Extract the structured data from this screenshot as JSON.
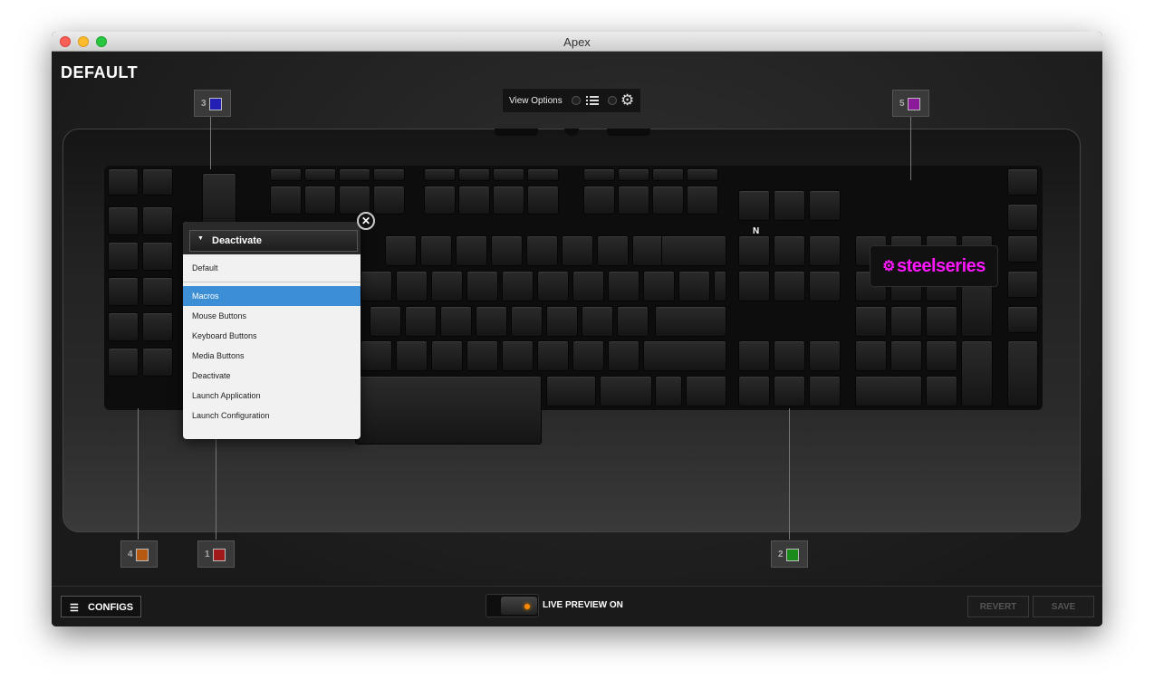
{
  "window": {
    "title": "Apex"
  },
  "config_name": "DEFAULT",
  "view_options": {
    "label": "View Options",
    "list_icon": "list-icon",
    "settings_icon": "gear-icon"
  },
  "colors": {
    "orange": "#ff7a1a",
    "red": "#ff1a1a",
    "green": "#1aff1a",
    "blue": "#2a33ff",
    "magenta": "#ff17ff"
  },
  "callouts": [
    {
      "num": "3",
      "color": "#241fb4"
    },
    {
      "num": "5",
      "color": "#8a1a9a"
    },
    {
      "num": "4",
      "color": "#b55a10"
    },
    {
      "num": "1",
      "color": "#a01a1a"
    },
    {
      "num": "2",
      "color": "#1a8a1a"
    }
  ],
  "n_label": "N",
  "logo": "steelseries",
  "popup": {
    "selected": "Deactivate",
    "items": [
      "Default",
      "Macros",
      "Mouse Buttons",
      "Keyboard Buttons",
      "Media Buttons",
      "Deactivate",
      "Launch Application",
      "Launch Configuration"
    ],
    "active_item": "Macros"
  },
  "bottom": {
    "configs": "CONFIGS",
    "live_preview": "LIVE PREVIEW ON",
    "revert": "REVERT",
    "save": "SAVE"
  }
}
